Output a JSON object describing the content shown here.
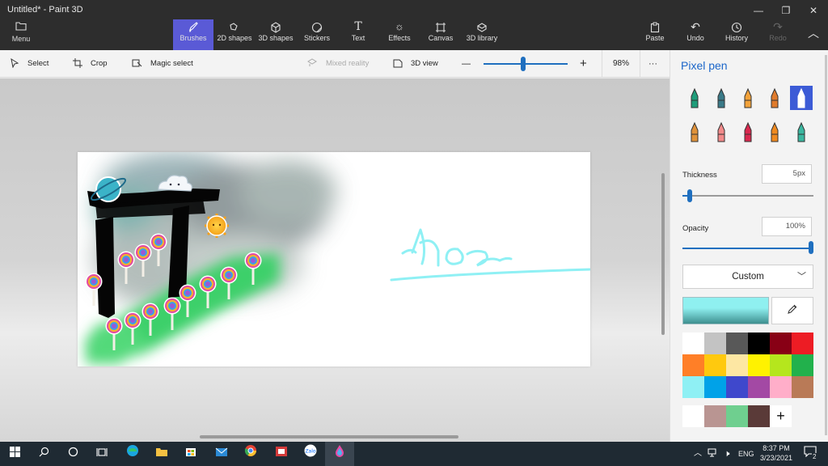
{
  "window": {
    "title": "Untitled* - Paint 3D",
    "controls": [
      "minimize-icon",
      "maximize-icon",
      "close-icon"
    ]
  },
  "ribbon": {
    "menu_label": "Menu",
    "tools": [
      {
        "label": "Brushes",
        "icon": "brush-icon",
        "active": true
      },
      {
        "label": "2D shapes",
        "icon": "2d-shapes-icon"
      },
      {
        "label": "3D shapes",
        "icon": "3d-shapes-icon"
      },
      {
        "label": "Stickers",
        "icon": "sticker-icon"
      },
      {
        "label": "Text",
        "icon": "text-icon"
      },
      {
        "label": "Effects",
        "icon": "effects-icon"
      },
      {
        "label": "Canvas",
        "icon": "canvas-icon"
      },
      {
        "label": "3D library",
        "icon": "3d-library-icon"
      }
    ],
    "right": [
      {
        "label": "Paste",
        "icon": "paste-icon"
      },
      {
        "label": "Undo",
        "icon": "undo-icon"
      },
      {
        "label": "History",
        "icon": "history-icon"
      },
      {
        "label": "Redo",
        "icon": "redo-icon",
        "disabled": true
      }
    ]
  },
  "toolbar": {
    "select": "Select",
    "crop": "Crop",
    "magic_select": "Magic select",
    "mixed_reality": "Mixed reality",
    "view_3d": "3D view",
    "zoom_minus": "—",
    "zoom_plus": "+",
    "zoom_value": "98%",
    "zoom_fraction": 0.47,
    "more": "···"
  },
  "canvas": {
    "handwriting": "hoa"
  },
  "panel": {
    "title": "Pixel pen",
    "brushes": [
      {
        "name": "marker-brush",
        "color": "#1f9d7a"
      },
      {
        "name": "calligraphy-pen-brush",
        "color": "#3a7a88"
      },
      {
        "name": "oil-brush",
        "color": "#f2a23a"
      },
      {
        "name": "watercolor-brush",
        "color": "#e07b2c"
      },
      {
        "name": "pixel-pen-brush",
        "color": "#ffffff",
        "active": true
      },
      {
        "name": "pencil-brush",
        "color": "#e0923a"
      },
      {
        "name": "eraser-brush",
        "color": "#f28a8a"
      },
      {
        "name": "crayon-brush",
        "color": "#d9284e"
      },
      {
        "name": "spray-can-brush",
        "color": "#f08a1f"
      },
      {
        "name": "fill-bucket-brush",
        "color": "#3ab7a0"
      }
    ],
    "thickness_label": "Thickness",
    "thickness_value": "5px",
    "thickness_fraction": 0.04,
    "opacity_label": "Opacity",
    "opacity_value": "100%",
    "opacity_fraction": 1.0,
    "color_mode": "Custom",
    "current_color": "#8ff0f0",
    "palette": [
      "#ffffff",
      "#c3c3c3",
      "#585858",
      "#000000",
      "#880015",
      "#ed1c24",
      "#ff7f27",
      "#ffc90e",
      "#fde7a3",
      "#fff200",
      "#b5e61d",
      "#22b14c",
      "#8ff0f4",
      "#00a2e8",
      "#3f48cc",
      "#a349a4",
      "#ffaec9",
      "#b97a57"
    ],
    "custom_colors": [
      "#ffffff",
      "#b99592",
      "#6fcf8f",
      "#5a3a38"
    ],
    "add_color": "+"
  },
  "taskbar": {
    "time": "8:37 PM",
    "date": "3/23/2021",
    "language": "ENG",
    "notification_count": "2"
  }
}
